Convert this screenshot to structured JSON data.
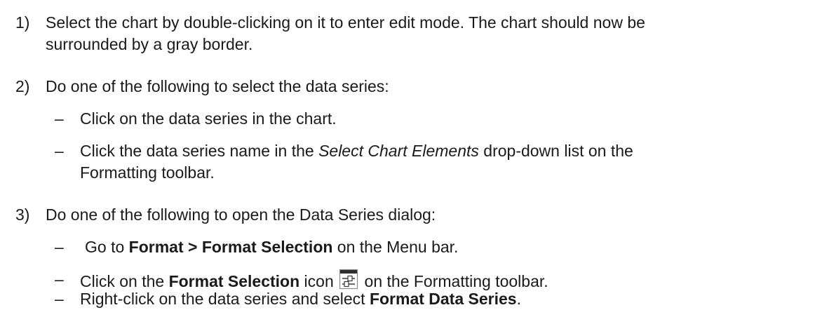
{
  "steps": [
    {
      "num": "1)",
      "text_line1": "Select the chart by double-clicking on it to enter edit mode. The chart should now be",
      "text_line2": "surrounded by a gray border."
    },
    {
      "num": "2)",
      "text": "Do one of the following to select the data series:",
      "subitems": [
        {
          "dash": "–",
          "text": "Click on the data series in the chart."
        },
        {
          "dash": "–",
          "pre": "Click the data series name in the ",
          "italic": "Select Chart Elements",
          "post_line1": " drop-down list on the",
          "line2": "Formatting toolbar."
        }
      ]
    },
    {
      "num": "3)",
      "text": "Do one of the following to open the Data Series dialog:",
      "subitems": [
        {
          "dash": "–",
          "pre": "Go to ",
          "bold": "Format > Format Selection",
          "post": " on the Menu bar."
        },
        {
          "dash": "–",
          "pre": "Click on the ",
          "bold": "Format Selection",
          "mid": " icon ",
          "icon": "format-selection-icon",
          "post": " on the Formatting toolbar."
        },
        {
          "dash": "–",
          "pre": "Right-click on the data series and select ",
          "bold": "Format Data Series",
          "post": "."
        }
      ]
    }
  ]
}
